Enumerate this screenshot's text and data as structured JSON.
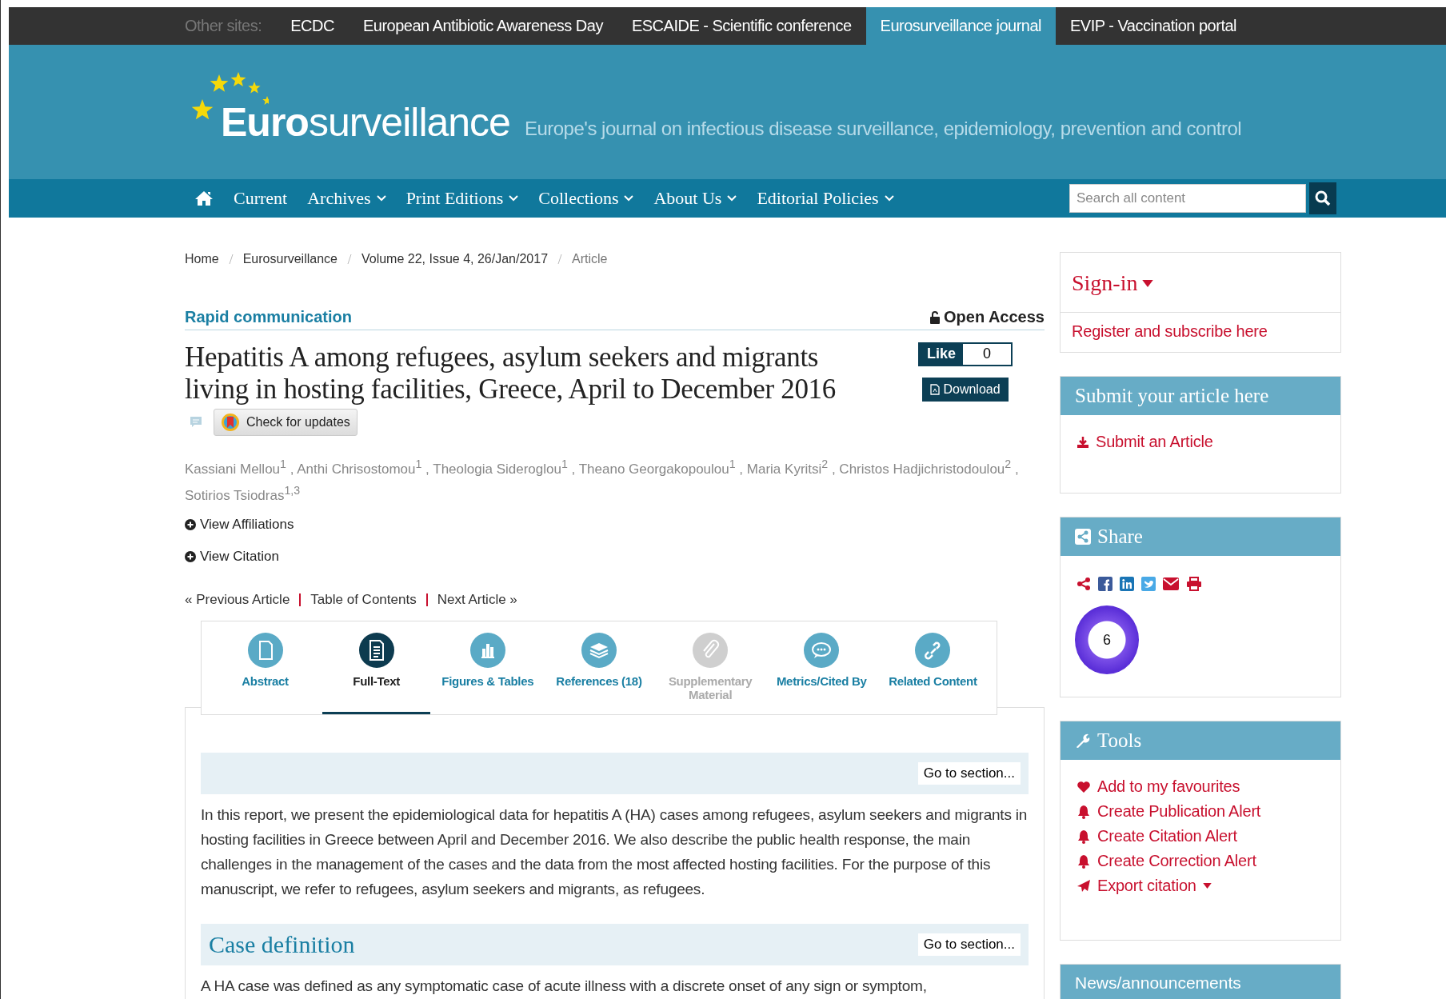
{
  "other_sites": {
    "label": "Other sites:",
    "links": [
      {
        "label": "ECDC",
        "selected": false
      },
      {
        "label": "European Antibiotic Awareness Day",
        "selected": false
      },
      {
        "label": "ESCAIDE - Scientific conference",
        "selected": false
      },
      {
        "label": "Eurosurveillance journal",
        "selected": true
      },
      {
        "label": "EVIP - Vaccination portal",
        "selected": false
      }
    ]
  },
  "header": {
    "logo": "**Euro**surveillance",
    "tagline": "Europe's journal on infectious disease surveillance, epidemiology, prevention and control"
  },
  "nav": {
    "items": [
      {
        "label": "Current",
        "dropdown": false
      },
      {
        "label": "Archives",
        "dropdown": true
      },
      {
        "label": "Print Editions",
        "dropdown": true
      },
      {
        "label": "Collections",
        "dropdown": true
      },
      {
        "label": "About Us",
        "dropdown": true
      },
      {
        "label": "Editorial Policies",
        "dropdown": true
      }
    ],
    "search": {
      "placeholder": "Search all content"
    }
  },
  "breadcrumb": [
    "Home",
    "Eurosurveillance",
    "Volume 22, Issue 4, 26/Jan/2017",
    "Article"
  ],
  "article": {
    "type": "Rapid communication",
    "access": "Open Access",
    "title": "Hepatitis A among refugees, asylum seekers and migrants living in hosting facilities, Greece, April to December 2016",
    "like": {
      "label": "Like",
      "count": "0"
    },
    "download": "Download",
    "check_updates": "Check for updates",
    "authors": "Kassiani Mellou$^{1}$ , Anthi Chrisostomou$^{1}$ , Theologia Sideroglou$^{1}$ , Theano Georgakopoulou$^{1}$ , Maria Kyritsi$^{2}$ , Christos Hadjichristodoulou$^{2}$ , Sotirios Tsiodras$^{1,3}$",
    "toggles": [
      "View Affiliations",
      "View Citation"
    ],
    "pager": [
      "« Previous Article",
      "Table of Contents",
      "Next Article »"
    ]
  },
  "tabs": [
    {
      "label": "Abstract",
      "kind": "page",
      "selected": false,
      "disabled": false
    },
    {
      "label": "Full-Text",
      "kind": "lines",
      "selected": true,
      "disabled": false
    },
    {
      "label": "Figures & Tables",
      "kind": "bars",
      "selected": false,
      "disabled": false
    },
    {
      "label": "References (18)",
      "kind": "stack",
      "selected": false,
      "disabled": false
    },
    {
      "label": "Supplementary Material",
      "kind": "clip",
      "selected": false,
      "disabled": true
    },
    {
      "label": "Metrics/Cited By",
      "kind": "chat",
      "selected": false,
      "disabled": false
    },
    {
      "label": "Related Content",
      "kind": "link",
      "selected": false,
      "disabled": false
    }
  ],
  "sections": [
    {
      "goto": "Go to section...",
      "text": "In this report, we present the epidemiological data for hepatitis A (HA) cases among refugees, asylum seekers and migrants in hosting facilities in Greece between April and December 2016. We also describe the public health response, the main challenges in the management of the cases and the data from the most affected hosting facilities. For the purpose of this manuscript, we refer to refugees, asylum seekers and migrants, as refugees."
    },
    {
      "heading": "Case definition",
      "goto": "Go to section...",
      "text": "A HA case was defined as any symptomatic case of acute illness with a discrete onset of any sign or symptom,"
    }
  ],
  "sidebar": {
    "signin": {
      "title": "Sign-in",
      "link": "Register and subscribe here"
    },
    "submit": {
      "title": "Submit your article here",
      "link": "Submit an Article"
    },
    "share": {
      "title": "Share",
      "altmetric": "6"
    },
    "tools": {
      "title": "Tools",
      "items": [
        {
          "label": "Add to my favourites",
          "kind": "heart",
          "dropdown": false
        },
        {
          "label": "Create Publication Alert",
          "kind": "bell",
          "dropdown": false
        },
        {
          "label": "Create Citation Alert",
          "kind": "bell",
          "dropdown": false
        },
        {
          "label": "Create Correction Alert",
          "kind": "bell",
          "dropdown": false
        },
        {
          "label": "Export citation",
          "kind": "plane",
          "dropdown": true
        }
      ]
    },
    "news": {
      "title": "News/announcements"
    }
  }
}
